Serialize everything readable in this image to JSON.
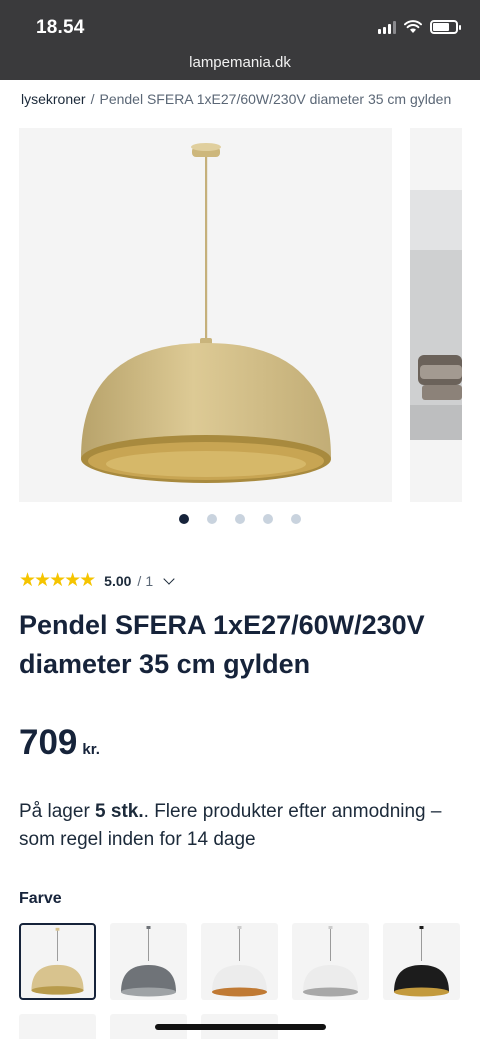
{
  "status_bar": {
    "time": "18.54"
  },
  "browser": {
    "url": "lampemania.dk"
  },
  "breadcrumb": {
    "parent": "lysekroner",
    "separator": "/",
    "current": "Pendel SFERA 1xE27/60W/230V diameter 35 cm gylden"
  },
  "gallery": {
    "image_count": 5,
    "active_index": 0
  },
  "rating": {
    "stars": "★★★★★",
    "score": "5.00",
    "separator": "/",
    "count": "1"
  },
  "product": {
    "title": "Pendel SFERA 1xE27/60W/230V diameter 35 cm gylden",
    "price_value": "709",
    "price_currency": "kr."
  },
  "stock": {
    "prefix": "På lager ",
    "quantity": "5 stk.",
    "suffix": ". Flere produkter efter anmodning – som regel inden for 14 dage"
  },
  "color_section": {
    "label": "Farve",
    "options": [
      {
        "name": "gold",
        "outer": "#d8c38e",
        "inner": "#b89b4c",
        "selected": true
      },
      {
        "name": "grey",
        "outer": "#6f7378",
        "inner": "#9fa3a6",
        "selected": false
      },
      {
        "name": "white-copper",
        "outer": "#ececec",
        "inner": "#c07a34",
        "selected": false
      },
      {
        "name": "white-silver",
        "outer": "#ececec",
        "inner": "#a8a8a8",
        "selected": false
      },
      {
        "name": "black-gold",
        "outer": "#1c1c1c",
        "inner": "#c39a3d",
        "selected": false
      }
    ]
  },
  "colors": {
    "navy": "#16233a",
    "star": "#f5c400",
    "dot_inactive": "#c9d3de",
    "lamp_gold": "#d6c18a"
  }
}
